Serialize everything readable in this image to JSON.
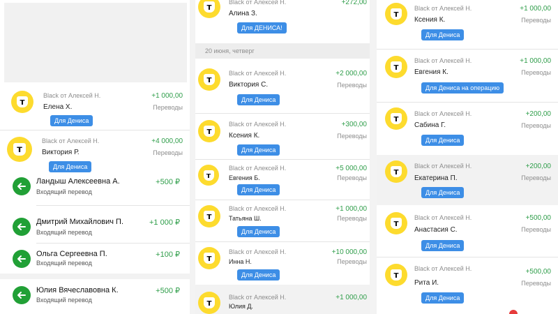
{
  "brand": {
    "logo_letter": "т"
  },
  "colors": {
    "accent_blue": "#3d8ee6",
    "income_green": "#2e9d49",
    "logo_yellow": "#fddb2e",
    "arrow_green": "#21a036"
  },
  "icons": {
    "logo": "tinkoff-shield-icon",
    "incoming": "arrow-left-icon"
  },
  "left": {
    "card_items": [
      {
        "sender": "Black от Алексей Н.",
        "name": "Елена Х.",
        "amount": "+1 000,00",
        "category": "Переводы",
        "tag": "Для Дениса"
      },
      {
        "sender": "Black от Алексей Н.",
        "name": "Виктория Р.",
        "amount": "+4 000,00",
        "category": "Переводы",
        "tag": "Для Дениса"
      }
    ],
    "incoming": [
      {
        "name": "Ландыш Алексеевна А.",
        "sub": "Входящий перевод",
        "amount": "+500 ₽"
      },
      {
        "name": "Дмитрий Михайлович П.",
        "sub": "Входящий перевод",
        "amount": "+1 000 ₽"
      },
      {
        "name": "Ольга Сергеевна П.",
        "sub": "Входящий перевод",
        "amount": "+100 ₽"
      },
      {
        "name": "Юлия Вячеславовна К.",
        "sub": "Входящий перевод",
        "amount": "+500 ₽"
      }
    ]
  },
  "middle": {
    "date_header": "20 июня, четверг",
    "items": [
      {
        "sender": "Black от Алексей Н.",
        "name": "Алина З.",
        "amount": "+272,00",
        "category": "",
        "tag": "Для ДЕНИСА!"
      },
      {
        "sender": "Black от Алексей Н.",
        "name": "Виктория С.",
        "amount": "+2 000,00",
        "category": "Переводы",
        "tag": "Для Дениса"
      },
      {
        "sender": "Black от Алексей Н.",
        "name": "Ксения К.",
        "amount": "+300,00",
        "category": "Переводы",
        "tag": "Для Дениса"
      },
      {
        "sender": "Black от Алексей Н.",
        "name": "Евгения Б.",
        "amount": "+5 000,00",
        "category": "Переводы",
        "tag": "Для Дениса"
      },
      {
        "sender": "Black от Алексей Н.",
        "name": "Татьяна Ш.",
        "amount": "+1 000,00",
        "category": "Переводы",
        "tag": "Для Дениса"
      },
      {
        "sender": "Black от Алексей Н.",
        "name": "Инна Н.",
        "amount": "+10 000,00",
        "category": "Переводы",
        "tag": "Для Дениса"
      },
      {
        "sender": "Black от Алексей Н.",
        "name": "Юлия Д.",
        "amount": "+1 000,00",
        "category": "",
        "tag": ""
      }
    ]
  },
  "right": {
    "items": [
      {
        "sender": "Black от Алексей Н.",
        "name": "Ксения К.",
        "amount": "+1 000,00",
        "category": "Переводы",
        "tag": "Для Дениса"
      },
      {
        "sender": "Black от Алексей Н.",
        "name": "Евгения К.",
        "amount": "+1 000,00",
        "category": "Переводы",
        "tag": "Для Дениса на операцию"
      },
      {
        "sender": "Black от Алексей Н.",
        "name": "Сабина Г.",
        "amount": "+200,00",
        "category": "Переводы",
        "tag": "Для Дениса"
      },
      {
        "sender": "Black от Алексей Н.",
        "name": "Екатерина П.",
        "amount": "+200,00",
        "category": "Переводы",
        "tag": "Для Дениса"
      },
      {
        "sender": "Black от Алексей Н.",
        "name": "Анастасия С.",
        "amount": "+500,00",
        "category": "Переводы",
        "tag": "Для Дениса"
      },
      {
        "sender": "Black от Алексей Н.",
        "name": "Рита И.",
        "amount": "+500,00",
        "category": "Переводы",
        "tag": "Для Дениса"
      }
    ]
  }
}
